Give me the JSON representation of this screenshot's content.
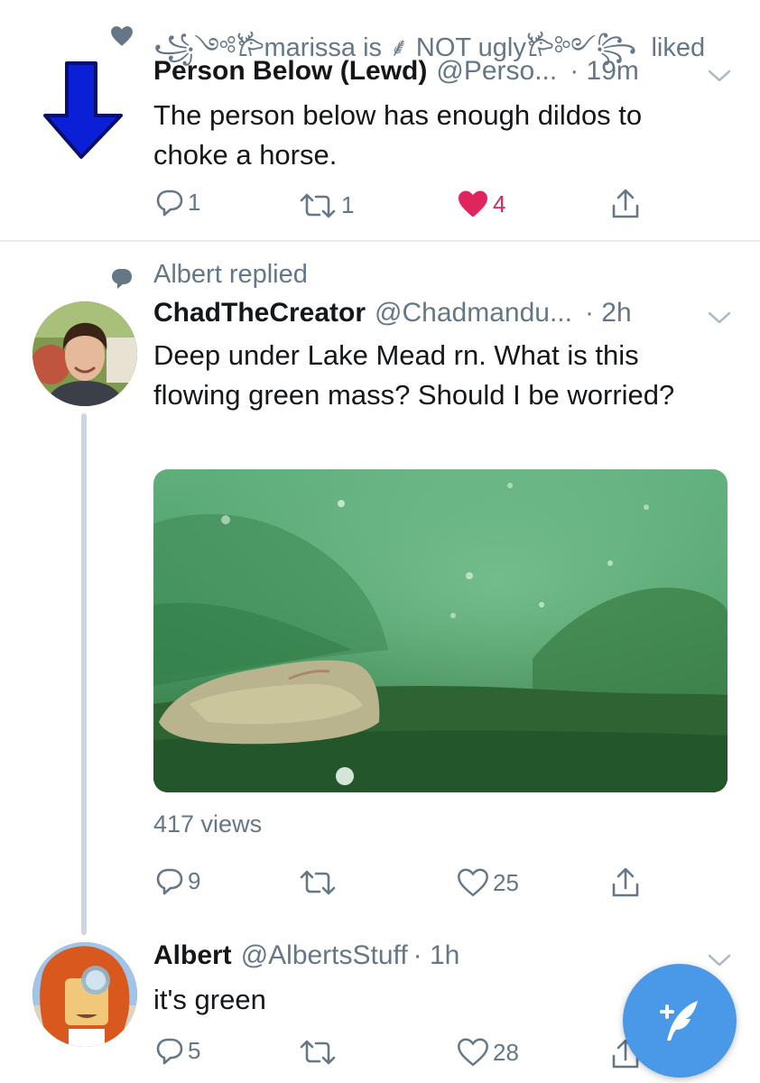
{
  "tweet1": {
    "context_user": "꧁༺𐂂marissa is ⸙ NOT ugly𐂂༻꧂",
    "context_action": "liked",
    "author_name": "Person Below (Lewd)",
    "author_handle": "@Perso...",
    "time": "· 19m",
    "text": "The person below has enough dildos to choke a horse.",
    "replies": "1",
    "retweets": "1",
    "likes": "4",
    "liked": true
  },
  "tweet2": {
    "context": "Albert replied",
    "author_name": "ChadTheCreator",
    "author_handle": "@Chadmandu...",
    "time": "· 2h",
    "text": "Deep under Lake Mead rn. What is this flowing green mass? Should I be worried?",
    "views": "417 views",
    "replies": "9",
    "retweets": "",
    "likes": "25"
  },
  "tweet3": {
    "author_name": "Albert",
    "author_handle": "@AlbertsStuff",
    "time": "· 1h",
    "text": "it's green",
    "replies": "5",
    "retweets": "",
    "likes": "28"
  },
  "icons": {
    "arrow": "down-arrow-icon",
    "heart": "heart-icon",
    "reply": "reply-icon",
    "retweet": "retweet-icon",
    "share": "share-icon",
    "compose": "compose-icon"
  },
  "colors": {
    "accent": "#1da1f2",
    "like": "#e0245e",
    "muted": "#657786",
    "fab": "#4a99e9"
  }
}
